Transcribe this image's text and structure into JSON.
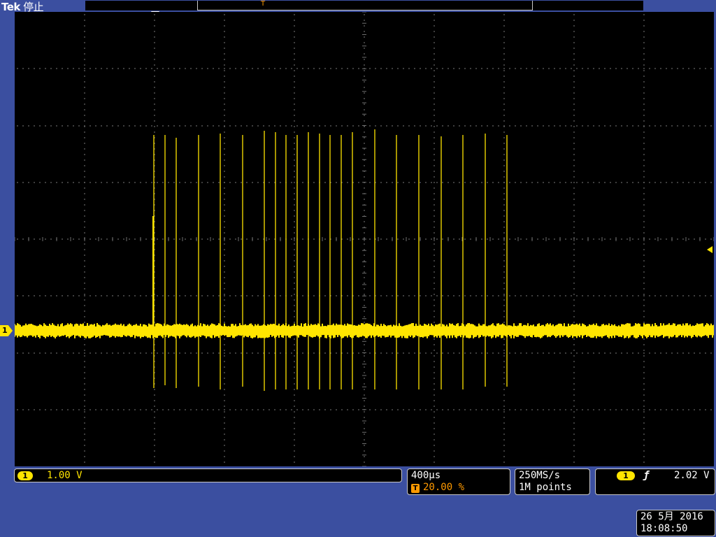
{
  "header": {
    "brand": "Tek",
    "status": "停止"
  },
  "record": {
    "trigger_marker": "T"
  },
  "trigger_position": {
    "badge": "T"
  },
  "channel": {
    "badge": "1",
    "scale": "1.00 V",
    "color": "#ffe500"
  },
  "timebase": {
    "scale": "400µs",
    "trigger_badge": "T",
    "trigger_position": "20.00 %",
    "trigger_color": "#ff9a00"
  },
  "acquisition": {
    "sample_rate": "250MS/s",
    "record_length": "1M points"
  },
  "trigger": {
    "source": "1",
    "slope": "rising-edge-icon",
    "slope_glyph": "ƒ",
    "level": "2.02 V"
  },
  "datetime": {
    "date": "26 5月 2016",
    "time": "18:08:50"
  },
  "colors": {
    "frame": "#3b4fa0",
    "screen": "#000000",
    "grid": "#6e6e6e"
  }
}
